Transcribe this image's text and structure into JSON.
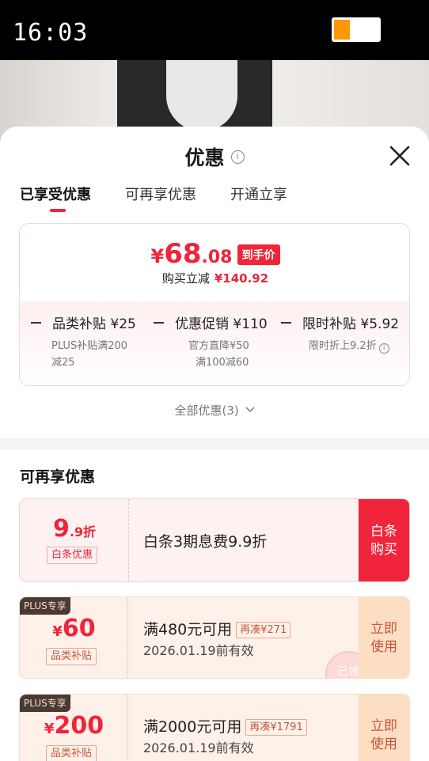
{
  "status_bar": {
    "time": "16:03",
    "battery_level": 0.35
  },
  "sheet": {
    "title": "优惠",
    "info_icon": "info-circle-icon",
    "close_icon": "close-icon",
    "tabs": [
      {
        "label": "已享受优惠",
        "active": true
      },
      {
        "label": "可再享优惠",
        "active": false
      },
      {
        "label": "开通立享",
        "active": false
      }
    ]
  },
  "price": {
    "currency": "¥",
    "integer": "68",
    "decimal": ".08",
    "tag": "到手价",
    "save_label": "购买立减",
    "save_amount": "¥140.92"
  },
  "subsidies": [
    {
      "title": "品类补贴 ¥25",
      "lines": [
        "PLUS补贴满200",
        "减25"
      ]
    },
    {
      "title": "优惠促销 ¥110",
      "lines": [
        "官方直降¥50",
        "满100减60"
      ]
    },
    {
      "title": "限时补贴 ¥5.92",
      "lines": [
        "限时折上9.2折"
      ]
    }
  ],
  "all_offers": "全部优惠(3)",
  "section_title": "可再享优惠",
  "coupons": [
    {
      "rate_int": "9",
      "rate_suffix": ".9折",
      "badge": "白条优惠",
      "text": "白条3期息费9.9折",
      "button_line1": "白条",
      "button_line2": "购买"
    },
    {
      "plus_tag": "PLUS专享",
      "currency": "¥",
      "amount": "60",
      "badge": "品类补贴",
      "condition": "满480元可用",
      "extra": "再凑¥271",
      "valid": "2026.01.19前有效",
      "button_line1": "立即",
      "button_line2": "使用",
      "stamp": "已领"
    },
    {
      "plus_tag": "PLUS专享",
      "currency": "¥",
      "amount": "200",
      "badge": "品类补贴",
      "condition": "满2000元可用",
      "extra": "再凑¥1791",
      "valid": "2026.01.19前有效",
      "button_line1": "立即",
      "button_line2": "使用"
    }
  ],
  "colors": {
    "accent": "#f0243a",
    "plus_dark": "#4a3a33",
    "coupon_orange": "#c4573a"
  }
}
